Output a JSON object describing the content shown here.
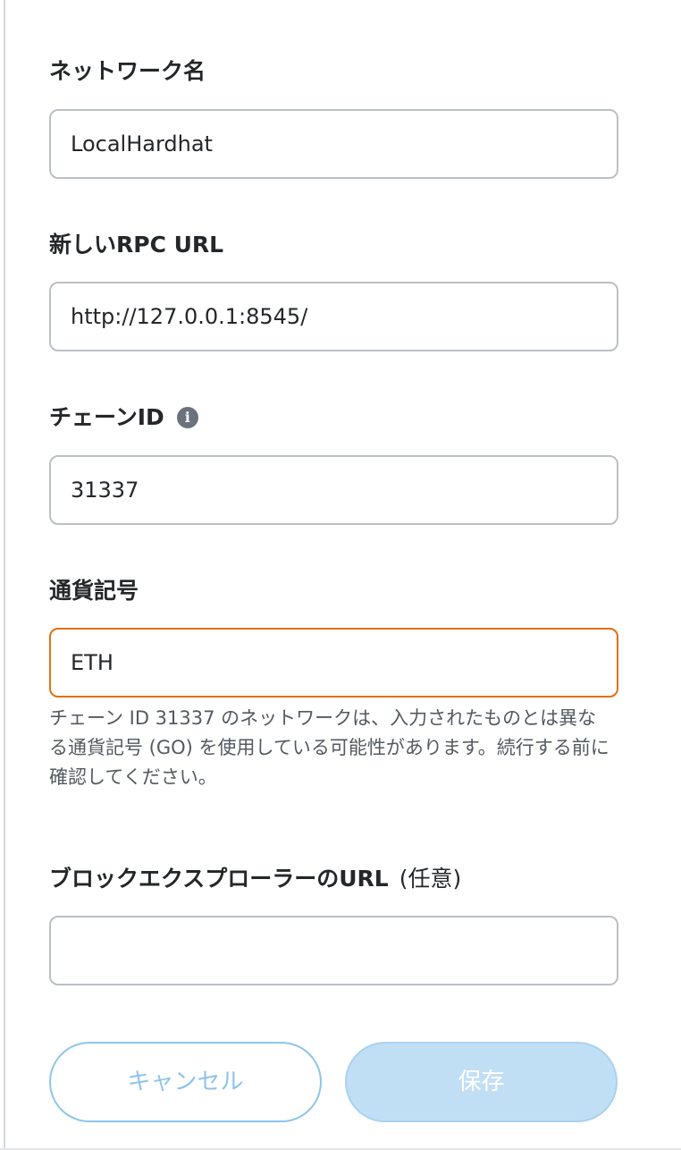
{
  "form": {
    "network_name": {
      "label": "ネットワーク名",
      "value": "LocalHardhat"
    },
    "rpc_url": {
      "label": "新しいRPC URL",
      "value": "http://127.0.0.1:8545/"
    },
    "chain_id": {
      "label": "チェーンID",
      "info_icon": "i",
      "value": "31337"
    },
    "currency_symbol": {
      "label": "通貨記号",
      "value": "ETH",
      "warning": "チェーン ID 31337 のネットワークは、入力されたものとは異なる通貨記号 (GO) を使用している可能性があります。続行する前に確認してください。"
    },
    "block_explorer": {
      "label": "ブロックエクスプローラーのURL",
      "optional": "(任意)",
      "value": ""
    }
  },
  "actions": {
    "cancel_label": "キャンセル",
    "save_label": "保存"
  },
  "colors": {
    "warning_border": "#e26f12",
    "primary_disabled": "#c1dff4",
    "secondary_border": "#8ec5eb"
  }
}
